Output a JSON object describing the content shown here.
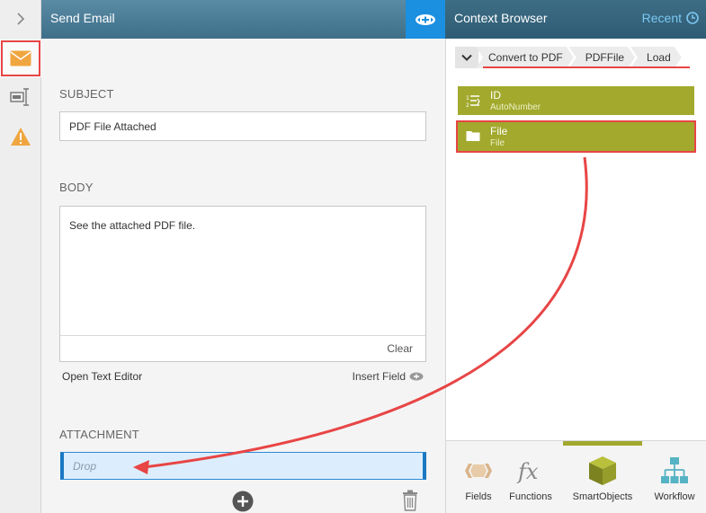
{
  "left_panel": {
    "title": "Send Email",
    "subject": {
      "label": "SUBJECT",
      "value": "PDF File Attached"
    },
    "body": {
      "label": "BODY",
      "value": "See the attached PDF file.",
      "clear_label": "Clear"
    },
    "open_text_editor": "Open Text Editor",
    "insert_field": "Insert Field",
    "attachment": {
      "label": "ATTACHMENT",
      "placeholder": "Drop"
    }
  },
  "context_browser": {
    "title": "Context Browser",
    "recent_label": "Recent",
    "breadcrumb": [
      "Convert to PDF",
      "PDFFile",
      "Load"
    ],
    "fields": [
      {
        "name": "ID",
        "type": "AutoNumber",
        "icon": "autonumber-icon"
      },
      {
        "name": "File",
        "type": "File",
        "icon": "folder-icon"
      }
    ],
    "tabs": [
      {
        "label": "Fields",
        "icon": "fields-icon"
      },
      {
        "label": "Functions",
        "icon": "fx-icon"
      },
      {
        "label": "SmartObjects",
        "icon": "cube-icon"
      },
      {
        "label": "Workflow",
        "icon": "workflow-icon"
      }
    ]
  },
  "colors": {
    "accent_blue": "#1b8fe0",
    "field_olive": "#a2a92d",
    "highlight_red": "#e84545",
    "recent_link": "#7cc8f2"
  }
}
